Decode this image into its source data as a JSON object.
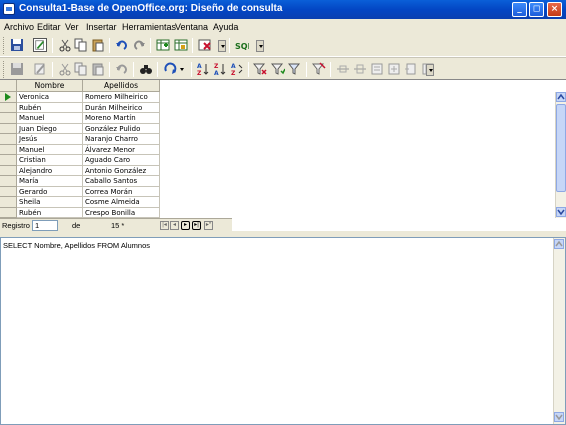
{
  "window": {
    "title": "Consulta1-Base de OpenOffice.org: Diseño de consulta"
  },
  "menu": [
    "Archivo",
    "Editar",
    "Ver",
    "Insertar",
    "Herramientas",
    "Ventana",
    "Ayuda"
  ],
  "grid": {
    "columns": [
      "Nombre",
      "Apellidos"
    ],
    "rows": [
      [
        "Veronica",
        "Romero Milheirico"
      ],
      [
        "Rubén",
        "Durán Milheirico"
      ],
      [
        "Manuel",
        "Moreno Martín"
      ],
      [
        "Juan Diego",
        "González Pulido"
      ],
      [
        "Jesús",
        "Naranjo Charro"
      ],
      [
        "Manuel",
        "Álvarez Menor"
      ],
      [
        "Cristian",
        "Aguado Caro"
      ],
      [
        "Alejandro",
        "Antonio González"
      ],
      [
        "María",
        "Caballo Santos"
      ],
      [
        "Gerardo",
        "Correa Morán"
      ],
      [
        "Sheila",
        "Cosme Almeida"
      ],
      [
        "Rubén",
        "Crespo Bonilla"
      ]
    ]
  },
  "navigation": {
    "record_label": "Registro",
    "record_value": "1",
    "of_label": "de",
    "total": "15 *"
  },
  "sql": {
    "text": "SELECT Nombre, Apellidos FROM Alumnos"
  }
}
